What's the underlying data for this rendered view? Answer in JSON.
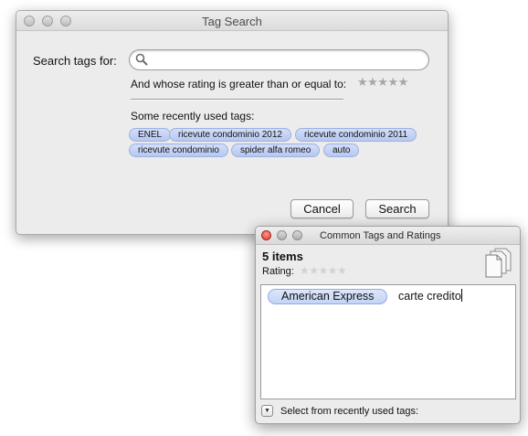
{
  "tag_search": {
    "title": "Tag Search",
    "search_label": "Search tags for:",
    "search_value": "",
    "rating_label": "And whose rating is greater than or equal to:",
    "rating_stars": "★★★★★",
    "rating_value": 0,
    "recent_label": "Some recently used tags:",
    "recent_tags": [
      "ENEL",
      "ricevute condominio 2012",
      "ricevute condominio 2011",
      "ricevute condominio",
      "spider alfa romeo",
      "auto"
    ],
    "cancel_label": "Cancel",
    "search_button_label": "Search"
  },
  "common_tags": {
    "title": "Common Tags and Ratings",
    "items_count": "5 items",
    "rating_label": "Rating:",
    "rating_stars": "★★★★★",
    "rating_value": 0,
    "tags": [
      "American Express"
    ],
    "typed_text": "carte credito",
    "disclosure_glyph": "▼",
    "select_recent_label": "Select from recently used tags:"
  },
  "colors": {
    "tag_fill": "#c4d4f5",
    "tag_border": "#9cb1e0",
    "close_red": "#d8382a"
  },
  "icons": {
    "search": "magnifier-icon",
    "documents": "multiple-documents-icon",
    "disclosure": "disclosure-triangle-icon"
  }
}
